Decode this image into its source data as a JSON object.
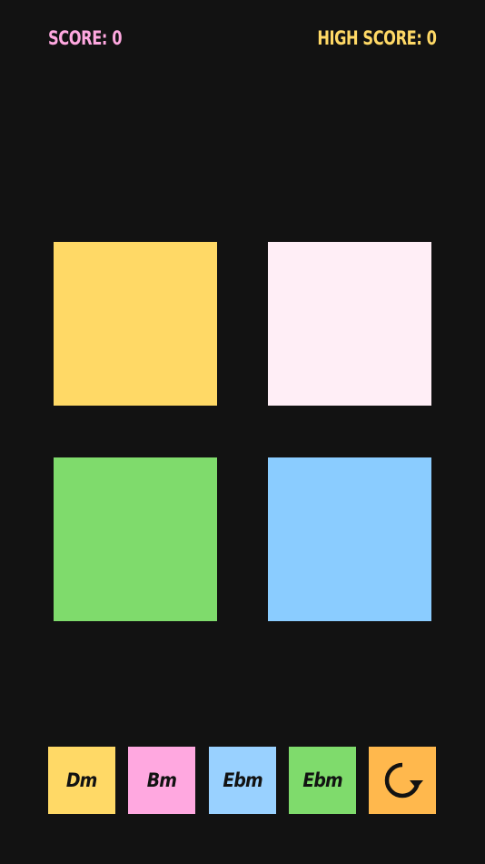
{
  "header": {
    "score_text": "SCORE: 0",
    "high_score_text": "HIGH SCORE: 0",
    "score_color": "#FFA8E0",
    "high_score_color": "#FFD966"
  },
  "pads": [
    {
      "name": "yellow",
      "color": "#FFD966"
    },
    {
      "name": "pink",
      "color": "#FFEEF6"
    },
    {
      "name": "green",
      "color": "#7FDB6C"
    },
    {
      "name": "blue",
      "color": "#8ACCFF"
    }
  ],
  "chord_buttons": [
    {
      "label": "Dm",
      "color": "#FFD966"
    },
    {
      "label": "Bm",
      "color": "#FFA8E0"
    },
    {
      "label": "Ebm",
      "color": "#99D1FF"
    },
    {
      "label": "Ebm",
      "color": "#7FDB6C"
    }
  ],
  "reset_button": {
    "icon": "reload-icon",
    "color": "#FFB84D"
  }
}
